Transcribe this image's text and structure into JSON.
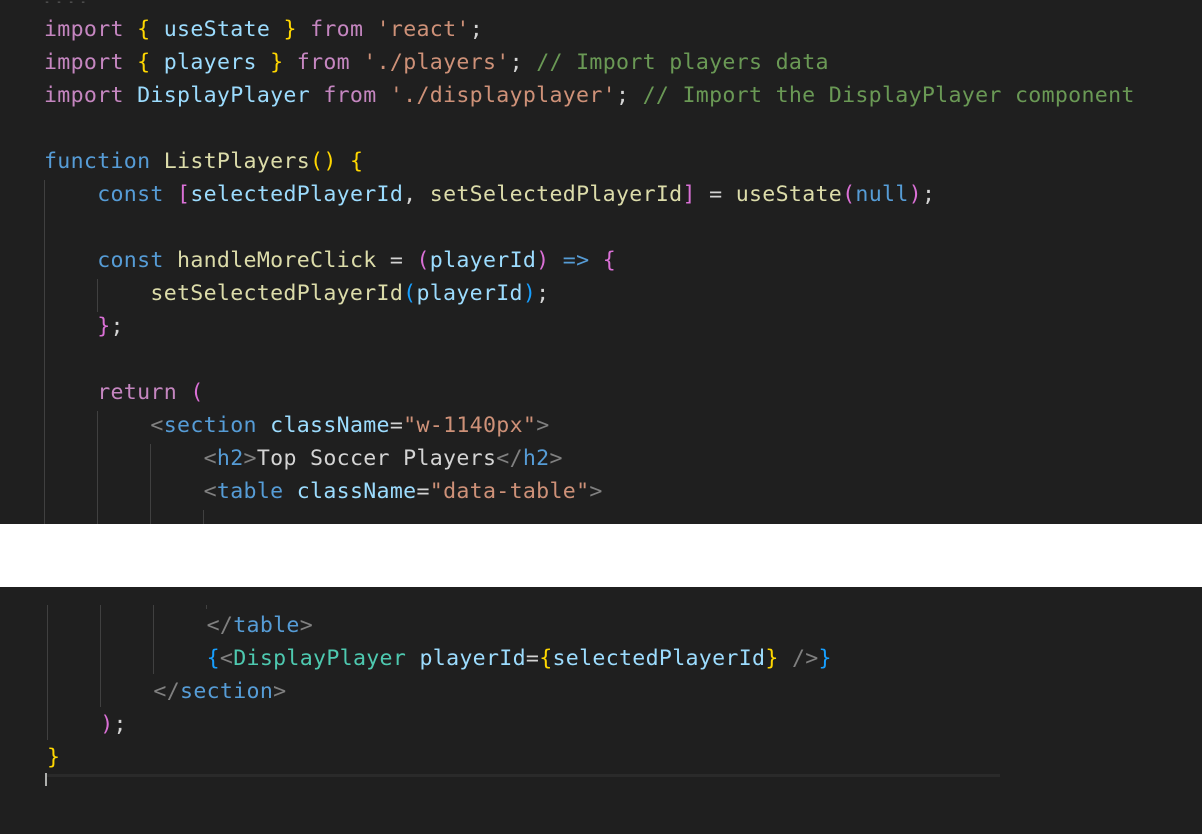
{
  "editor": {
    "theme": "dark",
    "background": "#1f1f1f",
    "top_pane": {
      "lines": [
        [
          {
            "text": "import",
            "cls": "k"
          },
          {
            "text": " ",
            "cls": "p"
          },
          {
            "text": "{",
            "cls": "y"
          },
          {
            "text": " useState ",
            "cls": "v"
          },
          {
            "text": "}",
            "cls": "y"
          },
          {
            "text": " ",
            "cls": "p"
          },
          {
            "text": "from",
            "cls": "k"
          },
          {
            "text": " ",
            "cls": "p"
          },
          {
            "text": "'react'",
            "cls": "s"
          },
          {
            "text": ";",
            "cls": "p"
          }
        ],
        [
          {
            "text": "import",
            "cls": "k"
          },
          {
            "text": " ",
            "cls": "p"
          },
          {
            "text": "{",
            "cls": "y"
          },
          {
            "text": " players ",
            "cls": "v"
          },
          {
            "text": "}",
            "cls": "y"
          },
          {
            "text": " ",
            "cls": "p"
          },
          {
            "text": "from",
            "cls": "k"
          },
          {
            "text": " ",
            "cls": "p"
          },
          {
            "text": "'./players'",
            "cls": "s"
          },
          {
            "text": "; ",
            "cls": "p"
          },
          {
            "text": "// Import players data",
            "cls": "c"
          }
        ],
        [
          {
            "text": "import",
            "cls": "k"
          },
          {
            "text": " DisplayPlayer ",
            "cls": "v"
          },
          {
            "text": "from",
            "cls": "k"
          },
          {
            "text": " ",
            "cls": "p"
          },
          {
            "text": "'./displayplayer'",
            "cls": "s"
          },
          {
            "text": "; ",
            "cls": "p"
          },
          {
            "text": "// Import the DisplayPlayer component",
            "cls": "c"
          }
        ],
        [],
        [
          {
            "text": "function",
            "cls": "b"
          },
          {
            "text": " ",
            "cls": "p"
          },
          {
            "text": "ListPlayers",
            "cls": "f"
          },
          {
            "text": "()",
            "cls": "y"
          },
          {
            "text": " ",
            "cls": "p"
          },
          {
            "text": "{",
            "cls": "y"
          }
        ],
        [
          {
            "text": "    ",
            "cls": "p"
          },
          {
            "text": "const",
            "cls": "b"
          },
          {
            "text": " ",
            "cls": "p"
          },
          {
            "text": "[",
            "cls": "m"
          },
          {
            "text": "selectedPlayerId",
            "cls": "v"
          },
          {
            "text": ", ",
            "cls": "p"
          },
          {
            "text": "setSelectedPlayerId",
            "cls": "f"
          },
          {
            "text": "]",
            "cls": "m"
          },
          {
            "text": " = ",
            "cls": "p"
          },
          {
            "text": "useState",
            "cls": "f"
          },
          {
            "text": "(",
            "cls": "m"
          },
          {
            "text": "null",
            "cls": "b"
          },
          {
            "text": ")",
            "cls": "m"
          },
          {
            "text": ";",
            "cls": "p"
          }
        ],
        [],
        [
          {
            "text": "    ",
            "cls": "p"
          },
          {
            "text": "const",
            "cls": "b"
          },
          {
            "text": " ",
            "cls": "p"
          },
          {
            "text": "handleMoreClick",
            "cls": "f"
          },
          {
            "text": " = ",
            "cls": "p"
          },
          {
            "text": "(",
            "cls": "m"
          },
          {
            "text": "playerId",
            "cls": "v"
          },
          {
            "text": ")",
            "cls": "m"
          },
          {
            "text": " ",
            "cls": "p"
          },
          {
            "text": "=>",
            "cls": "b"
          },
          {
            "text": " ",
            "cls": "p"
          },
          {
            "text": "{",
            "cls": "m"
          }
        ],
        [
          {
            "text": "        ",
            "cls": "p"
          },
          {
            "text": "setSelectedPlayerId",
            "cls": "f"
          },
          {
            "text": "(",
            "cls": "bl"
          },
          {
            "text": "playerId",
            "cls": "v"
          },
          {
            "text": ")",
            "cls": "bl"
          },
          {
            "text": ";",
            "cls": "p"
          }
        ],
        [
          {
            "text": "    ",
            "cls": "p"
          },
          {
            "text": "}",
            "cls": "m"
          },
          {
            "text": ";",
            "cls": "p"
          }
        ],
        [],
        [
          {
            "text": "    ",
            "cls": "p"
          },
          {
            "text": "return",
            "cls": "k"
          },
          {
            "text": " ",
            "cls": "p"
          },
          {
            "text": "(",
            "cls": "m"
          }
        ],
        [
          {
            "text": "        ",
            "cls": "p"
          },
          {
            "text": "<",
            "cls": "t"
          },
          {
            "text": "section",
            "cls": "b"
          },
          {
            "text": " ",
            "cls": "p"
          },
          {
            "text": "className",
            "cls": "v"
          },
          {
            "text": "=",
            "cls": "p"
          },
          {
            "text": "\"w-1140px\"",
            "cls": "s"
          },
          {
            "text": ">",
            "cls": "t"
          }
        ],
        [
          {
            "text": "            ",
            "cls": "p"
          },
          {
            "text": "<",
            "cls": "t"
          },
          {
            "text": "h2",
            "cls": "b"
          },
          {
            "text": ">",
            "cls": "t"
          },
          {
            "text": "Top Soccer Players",
            "cls": "txt"
          },
          {
            "text": "</",
            "cls": "t"
          },
          {
            "text": "h2",
            "cls": "b"
          },
          {
            "text": ">",
            "cls": "t"
          }
        ],
        [
          {
            "text": "            ",
            "cls": "p"
          },
          {
            "text": "<",
            "cls": "t"
          },
          {
            "text": "table",
            "cls": "b"
          },
          {
            "text": " ",
            "cls": "p"
          },
          {
            "text": "className",
            "cls": "v"
          },
          {
            "text": "=",
            "cls": "p"
          },
          {
            "text": "\"data-table\"",
            "cls": "s"
          },
          {
            "text": ">",
            "cls": "t"
          }
        ]
      ]
    },
    "bottom_pane": {
      "lines": [
        [
          {
            "text": "            ",
            "cls": "p"
          },
          {
            "text": "</",
            "cls": "t"
          },
          {
            "text": "table",
            "cls": "b"
          },
          {
            "text": ">",
            "cls": "t"
          }
        ],
        [
          {
            "text": "            ",
            "cls": "p"
          },
          {
            "text": "{",
            "cls": "bl"
          },
          {
            "text": "<",
            "cls": "t"
          },
          {
            "text": "DisplayPlayer",
            "cls": "comp"
          },
          {
            "text": " ",
            "cls": "p"
          },
          {
            "text": "playerId",
            "cls": "v"
          },
          {
            "text": "=",
            "cls": "p"
          },
          {
            "text": "{",
            "cls": "y"
          },
          {
            "text": "selectedPlayerId",
            "cls": "v"
          },
          {
            "text": "}",
            "cls": "y"
          },
          {
            "text": " ",
            "cls": "p"
          },
          {
            "text": "/>",
            "cls": "t"
          },
          {
            "text": "}",
            "cls": "bl"
          }
        ],
        [
          {
            "text": "        ",
            "cls": "p"
          },
          {
            "text": "</",
            "cls": "t"
          },
          {
            "text": "section",
            "cls": "b"
          },
          {
            "text": ">",
            "cls": "t"
          }
        ],
        [
          {
            "text": "    ",
            "cls": "p"
          },
          {
            "text": ")",
            "cls": "m"
          },
          {
            "text": ";",
            "cls": "p"
          }
        ],
        [
          {
            "text": "}",
            "cls": "y"
          }
        ],
        []
      ]
    }
  }
}
